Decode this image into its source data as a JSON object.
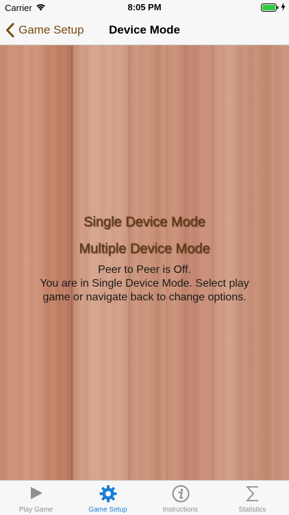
{
  "status_bar": {
    "carrier": "Carrier",
    "time": "8:05 PM"
  },
  "nav": {
    "back_label": "Game Setup",
    "title": "Device Mode"
  },
  "content": {
    "single_mode_label": "Single Device Mode",
    "multi_mode_label": "Multiple Device Mode",
    "status_lines": [
      "Peer to Peer is Off.",
      "You are in Single Device Mode. Select play",
      "game or navigate back to change options."
    ]
  },
  "tabs": [
    {
      "label": "Play Game",
      "icon": "play-icon",
      "active": false
    },
    {
      "label": "Game Setup",
      "icon": "gear-icon",
      "active": true
    },
    {
      "label": "Instructions",
      "icon": "info-icon",
      "active": false
    },
    {
      "label": "Statistics",
      "icon": "sigma-icon",
      "active": false
    }
  ],
  "colors": {
    "accent": "#7a4a10",
    "tab_active": "#1a7fd8",
    "tab_inactive": "#8e8e93"
  }
}
